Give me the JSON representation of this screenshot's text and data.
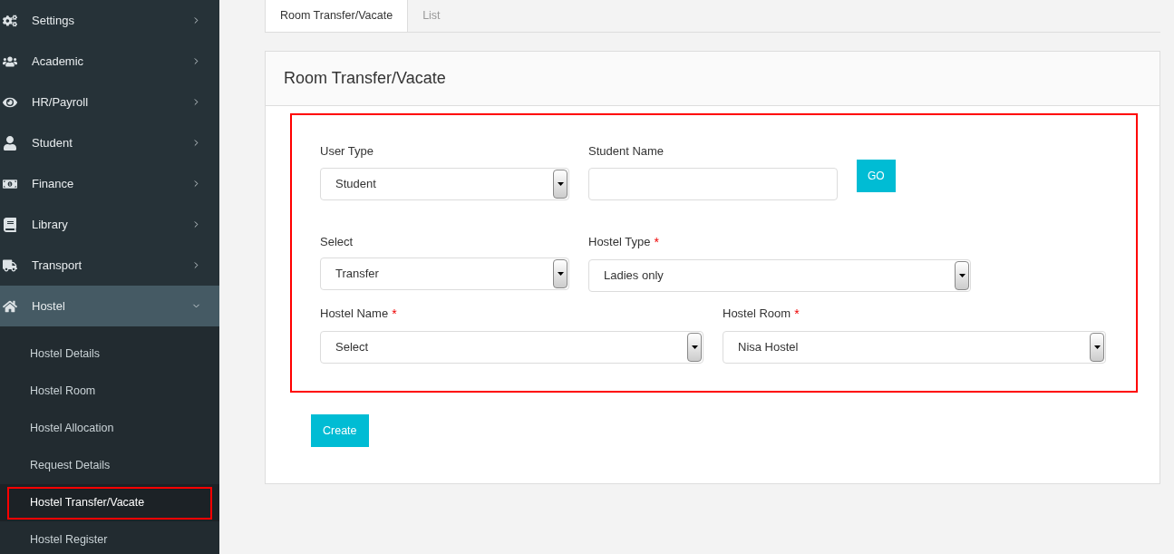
{
  "sidebar": {
    "items": [
      {
        "label": "Settings",
        "expanded": false,
        "selected": false
      },
      {
        "label": "Academic",
        "expanded": false,
        "selected": false
      },
      {
        "label": "HR/Payroll",
        "expanded": false,
        "selected": false
      },
      {
        "label": "Student",
        "expanded": false,
        "selected": false
      },
      {
        "label": "Finance",
        "expanded": false,
        "selected": false
      },
      {
        "label": "Library",
        "expanded": false,
        "selected": false
      },
      {
        "label": "Transport",
        "expanded": false,
        "selected": false
      },
      {
        "label": "Hostel",
        "expanded": true,
        "selected": true,
        "children": [
          {
            "label": "Hostel Details",
            "selected": false
          },
          {
            "label": "Hostel Room",
            "selected": false
          },
          {
            "label": "Hostel Allocation",
            "selected": false
          },
          {
            "label": "Request Details",
            "selected": false
          },
          {
            "label": "Hostel Transfer/Vacate",
            "selected": true
          },
          {
            "label": "Hostel Register",
            "selected": false
          }
        ]
      }
    ]
  },
  "tabs": [
    {
      "label": "Room Transfer/Vacate",
      "selected": true
    },
    {
      "label": "List",
      "selected": false
    }
  ],
  "panel": {
    "title": "Room Transfer/Vacate",
    "rows": [
      [
        {
          "kind": "select",
          "label": "User Type",
          "value": "Student"
        },
        {
          "kind": "input",
          "label": "Student Name"
        },
        {
          "kind": "button",
          "label": "GO"
        }
      ],
      [
        {
          "kind": "select",
          "label": "Select",
          "value": "Transfer"
        },
        {
          "kind": "select",
          "label": "Hostel Type",
          "required_mark": "*",
          "value": "Ladies only"
        }
      ],
      [
        {
          "kind": "select",
          "label": "Hostel Name",
          "required_mark": "*",
          "value": "Select"
        },
        {
          "kind": "select",
          "label": "Hostel Room",
          "required_mark": "*",
          "value": "Nisa Hostel"
        }
      ]
    ],
    "submit": "Create"
  }
}
